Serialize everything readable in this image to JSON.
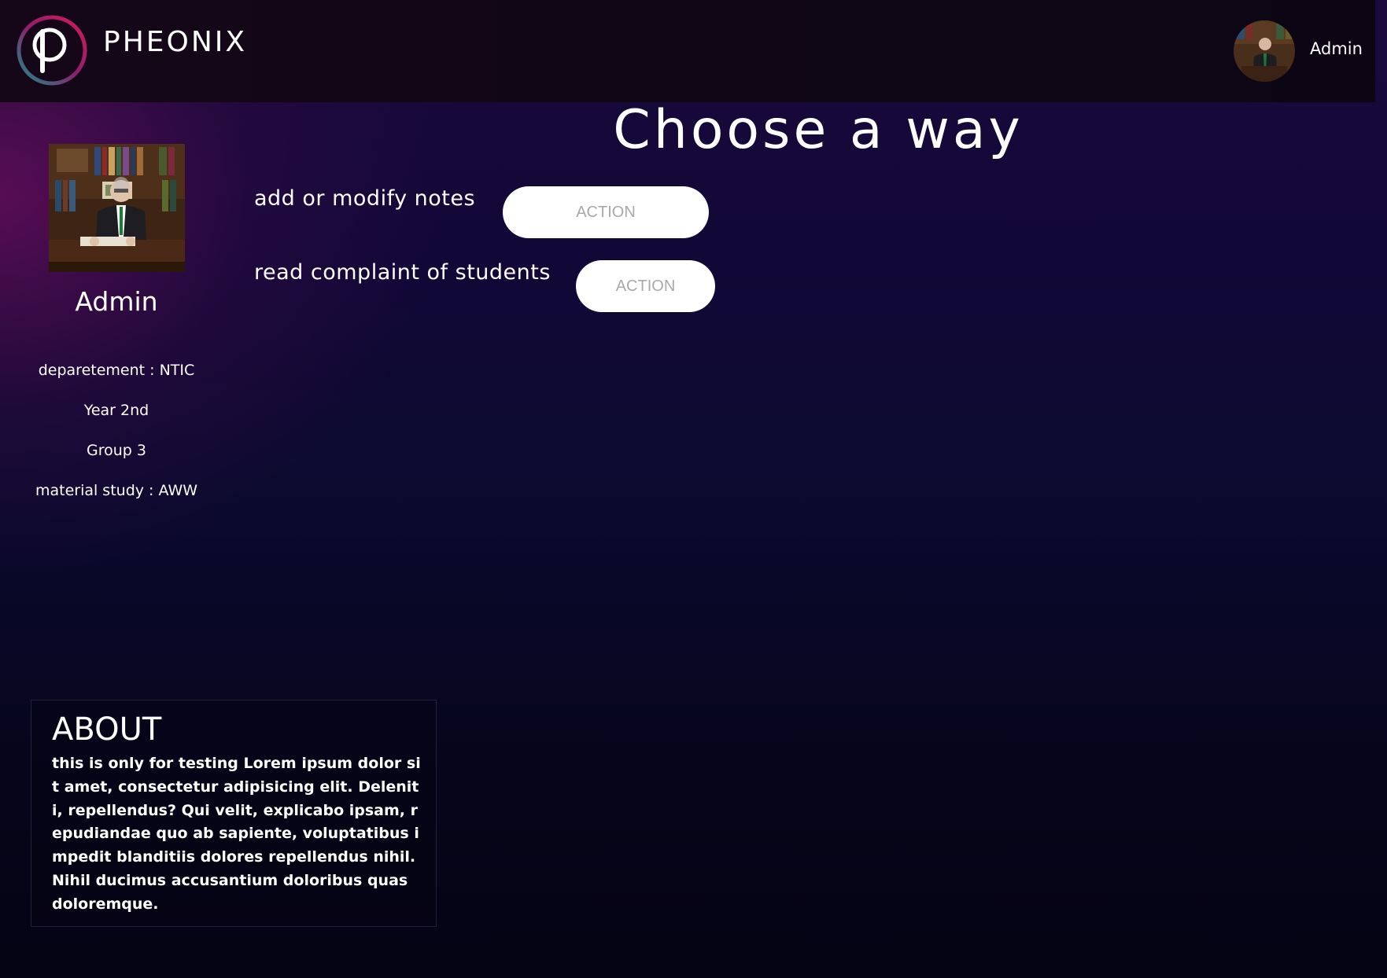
{
  "header": {
    "brand": "PHEONIX",
    "user_name": "Admin"
  },
  "profile": {
    "name": "Admin",
    "department": "deparetement : NTIC",
    "year": "Year 2nd",
    "group": "Group 3",
    "material": "material study : AWW"
  },
  "main": {
    "title": "Choose a way",
    "actions": [
      {
        "label": "add or modify notes",
        "button": "ACTION"
      },
      {
        "label": "read complaint of students",
        "button": "ACTION"
      }
    ]
  },
  "about": {
    "title": "ABOUT",
    "text": "this is only for testing Lorem ipsum dolor sit amet, consectetur adipisicing elit. Deleniti, repellendus? Qui velit, explicabo ipsam, repudiandae quo ab sapiente, voluptatibus impedit blanditiis dolores repellendus nihil. Nihil ducimus accusantium doloribus quas doloremque."
  },
  "colors": {
    "background_dark": "#070514",
    "accent_magenta": "#d6195e",
    "accent_teal": "#1c8c8c",
    "button_bg": "#ffffff",
    "button_text": "#a9a9a9"
  },
  "icons": {
    "logo": "pheonix-p-logo-icon",
    "avatar": "user-avatar-photo"
  }
}
